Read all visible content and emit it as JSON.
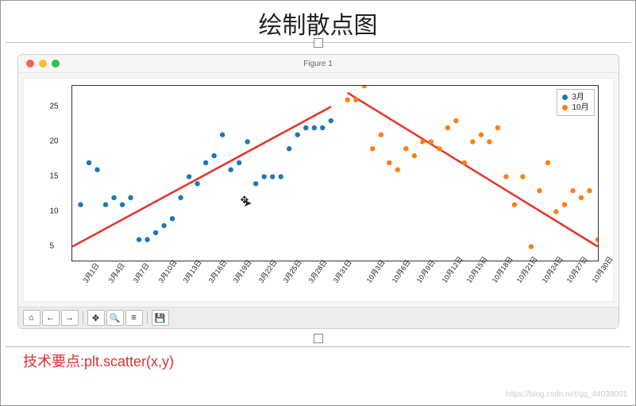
{
  "title": "绘制散点图",
  "window_title": "Figure 1",
  "legend": {
    "series1": "3月",
    "series2": "10月"
  },
  "toolbar": {
    "home": "⌂",
    "back": "←",
    "forward": "→",
    "pan": "✥",
    "zoom": "🔍",
    "subplots": "≡",
    "save": "💾"
  },
  "note": "技术要点:plt.scatter(x,y)",
  "watermark": "https://blog.csdn.net/qq_44038001",
  "chart_data": {
    "type": "scatter",
    "xlabel": "",
    "ylabel": "",
    "ylim": [
      3,
      28
    ],
    "yticks": [
      5,
      10,
      15,
      20,
      25
    ],
    "x_range": [
      0,
      63
    ],
    "x_tick_positions": [
      1,
      4,
      7,
      10,
      13,
      16,
      19,
      22,
      25,
      28,
      31,
      35,
      38,
      41,
      44,
      47,
      50,
      53,
      56,
      59,
      62
    ],
    "x_tick_labels": [
      "3月1日",
      "3月4日",
      "3月7日",
      "3月10日",
      "3月13日",
      "3月16日",
      "3月19日",
      "3月22日",
      "3月25日",
      "3月28日",
      "3月31日",
      "10月3日",
      "10月6日",
      "10月9日",
      "10月12日",
      "10月15日",
      "10月18日",
      "10月21日",
      "10月24日",
      "10月27日",
      "10月30日"
    ],
    "series": [
      {
        "name": "3月",
        "color": "#1f77b4",
        "x": [
          1,
          2,
          3,
          4,
          5,
          6,
          7,
          8,
          9,
          10,
          11,
          12,
          13,
          14,
          15,
          16,
          17,
          18,
          19,
          20,
          21,
          22,
          23,
          24,
          25,
          26,
          27,
          28,
          29,
          30,
          31
        ],
        "y": [
          11,
          17,
          16,
          11,
          12,
          11,
          12,
          6,
          6,
          7,
          8,
          9,
          12,
          15,
          14,
          17,
          18,
          21,
          16,
          17,
          20,
          14,
          15,
          15,
          15,
          19,
          21,
          22,
          22,
          22,
          23
        ]
      },
      {
        "name": "10月",
        "color": "#ff7f0e",
        "x": [
          33,
          34,
          35,
          36,
          37,
          38,
          39,
          40,
          41,
          42,
          43,
          44,
          45,
          46,
          47,
          48,
          49,
          50,
          51,
          52,
          53,
          54,
          55,
          56,
          57,
          58,
          59,
          60,
          61,
          62,
          63
        ],
        "y": [
          26,
          26,
          28,
          19,
          21,
          17,
          16,
          19,
          18,
          20,
          20,
          19,
          22,
          23,
          17,
          20,
          21,
          20,
          22,
          15,
          11,
          15,
          5,
          13,
          17,
          10,
          11,
          13,
          12,
          13,
          6
        ]
      }
    ],
    "trend_lines": [
      {
        "x1": 0,
        "y1": 5,
        "x2": 31,
        "y2": 25,
        "color": "#e4322b"
      },
      {
        "x1": 33,
        "y1": 27,
        "x2": 63,
        "y2": 5,
        "color": "#e4322b"
      }
    ]
  }
}
